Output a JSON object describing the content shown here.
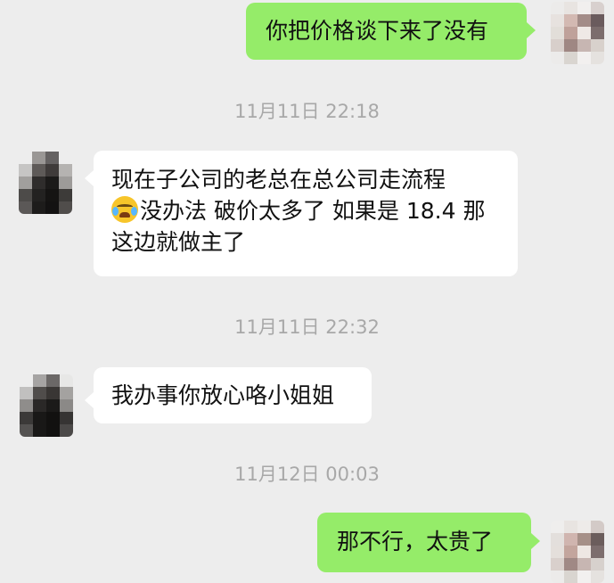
{
  "messages": [
    {
      "side": "right",
      "text": "你把价格谈下来了没有"
    },
    {
      "type": "timestamp",
      "text": "11月11日 22:18"
    },
    {
      "side": "left",
      "line1": "现在子公司的老总在总公司走流程",
      "line2_emoji": "crying-laughing-emoji",
      "line2": "没办法 破价太多了 如果是 18.4 那",
      "line3": "这边就做主了"
    },
    {
      "type": "timestamp",
      "text": "11月11日 22:32"
    },
    {
      "side": "left",
      "text": "我办事你放心咯小姐姐"
    },
    {
      "type": "timestamp",
      "text": "11月12日 00:03"
    },
    {
      "side": "right",
      "text": "那不行，太贵了"
    }
  ],
  "colors": {
    "background": "#ededed",
    "sent_bubble": "#95ec69",
    "received_bubble": "#ffffff",
    "timestamp": "#a8a8a8"
  }
}
